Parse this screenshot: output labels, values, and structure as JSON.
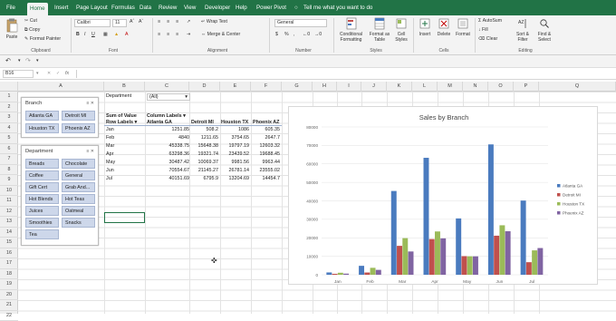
{
  "ribbon_tabs": [
    "File",
    "Home",
    "Insert",
    "Page Layout",
    "Formulas",
    "Data",
    "Review",
    "View",
    "Developer",
    "Help",
    "Power Pivot"
  ],
  "tell_me": "Tell me what you want to do",
  "clipboard": {
    "paste": "Paste",
    "cut": "Cut",
    "copy": "Copy",
    "format_painter": "Format Painter",
    "label": "Clipboard"
  },
  "font": {
    "name": "Calibri",
    "size": "11",
    "label": "Font"
  },
  "alignment": {
    "wrap": "Wrap Text",
    "merge": "Merge & Center",
    "label": "Alignment"
  },
  "number": {
    "format": "General",
    "label": "Number"
  },
  "styles": {
    "conditional": "Conditional Formatting",
    "format_table": "Format as Table",
    "cell_styles": "Cell Styles",
    "label": "Styles"
  },
  "cells_group": {
    "insert": "Insert",
    "delete": "Delete",
    "format": "Format",
    "label": "Cells"
  },
  "editing": {
    "autosum": "AutoSum",
    "fill": "Fill",
    "clear": "Clear",
    "sort": "Sort & Filter",
    "find": "Find & Select",
    "label": "Editing"
  },
  "formula_bar": {
    "name_box": "B16",
    "fx": "fx",
    "value": ""
  },
  "columns": [
    "A",
    "B",
    "C",
    "D",
    "E",
    "F",
    "G",
    "H",
    "I",
    "J",
    "K",
    "L",
    "M",
    "N",
    "O",
    "P",
    "Q"
  ],
  "rows": [
    "1",
    "2",
    "3",
    "4",
    "5",
    "6",
    "7",
    "8",
    "9",
    "10",
    "11",
    "12",
    "13",
    "14",
    "15",
    "16",
    "17",
    "18",
    "19",
    "20",
    "21",
    "22"
  ],
  "slicer_branch": {
    "title": "Branch",
    "items": [
      "Atlanta GA",
      "Detroit MI",
      "Houston TX",
      "Phoenix AZ"
    ]
  },
  "slicer_department": {
    "title": "Department",
    "items": [
      "Breads",
      "Chocolate",
      "Coffee",
      "General",
      "Gift Cert",
      "Grab And...",
      "Hot Blends",
      "Hot Teas",
      "Juices",
      "Oatmeal",
      "Smoothies",
      "Snacks",
      "Tea"
    ]
  },
  "pivot": {
    "filter_label": "Department",
    "filter_value": "(All)",
    "sum_label": "Sum of Value",
    "col_labels": "Column Labels",
    "row_labels": "Row Labels",
    "headers": [
      "Atlanta GA",
      "Detroit MI",
      "Houston TX",
      "Phoenix AZ"
    ],
    "rows": [
      {
        "month": "Jan",
        "values": [
          "1251.85",
          "508.2",
          "1086",
          "605.35"
        ]
      },
      {
        "month": "Feb",
        "values": [
          "4840",
          "1211.65",
          "3754.65",
          "2647.7"
        ]
      },
      {
        "month": "Mar",
        "values": [
          "45338.75",
          "15648.38",
          "19797.19",
          "12603.32"
        ]
      },
      {
        "month": "Apr",
        "values": [
          "63298.36",
          "19321.74",
          "23439.52",
          "19688.45"
        ]
      },
      {
        "month": "May",
        "values": [
          "30487.42",
          "10069.37",
          "9981.56",
          "9963.44"
        ]
      },
      {
        "month": "Jun",
        "values": [
          "70554.67",
          "21145.27",
          "26781.14",
          "23555.02"
        ]
      },
      {
        "month": "Jul",
        "values": [
          "40151.69",
          "6795.9",
          "13204.69",
          "14454.7"
        ]
      }
    ]
  },
  "chart_data": {
    "type": "bar",
    "title": "Sales by Branch",
    "categories": [
      "Jan",
      "Feb",
      "Mar",
      "Apr",
      "May",
      "Jun",
      "Jul"
    ],
    "ylim": [
      0,
      80000
    ],
    "yticks": [
      "0",
      "10000",
      "20000",
      "30000",
      "40000",
      "50000",
      "60000",
      "70000",
      "80000"
    ],
    "series": [
      {
        "name": "Atlanta GA",
        "color": "#4a7bbf",
        "values": [
          1251.85,
          4840,
          45338.75,
          63298.36,
          30487.42,
          70554.67,
          40151.69
        ]
      },
      {
        "name": "Detroit MI",
        "color": "#c0504d",
        "values": [
          508.2,
          1211.65,
          15648.38,
          19321.74,
          10069.37,
          21145.27,
          6795.9
        ]
      },
      {
        "name": "Houston TX",
        "color": "#9bbb59",
        "values": [
          1086,
          3754.65,
          19797.19,
          23439.52,
          9981.56,
          26781.14,
          13204.69
        ]
      },
      {
        "name": "Phoenix AZ",
        "color": "#8064a2",
        "values": [
          605.35,
          2647.7,
          12603.32,
          19688.45,
          9963.44,
          23555.02,
          14454.7
        ]
      }
    ],
    "legend": "right",
    "grid": true
  },
  "colors": {
    "excel_green": "#217346",
    "slicer_fill": "#cdd7ea"
  }
}
